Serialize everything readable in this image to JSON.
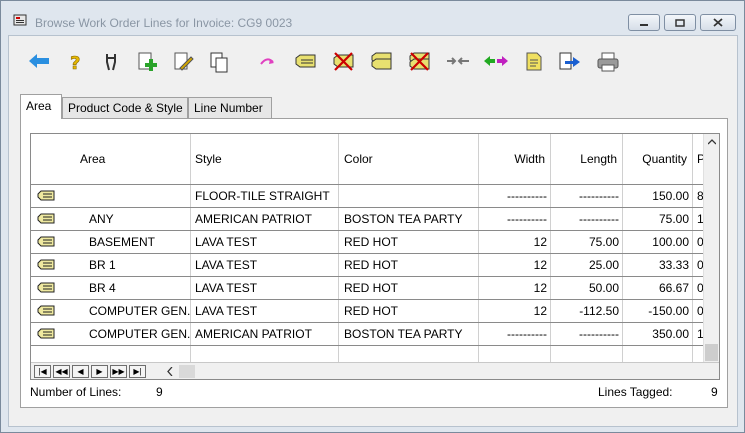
{
  "window": {
    "title": "Browse Work Order Lines for Invoice: CG9 0023"
  },
  "tabs": [
    {
      "label": "Area",
      "active": true
    },
    {
      "label": "Product Code & Style",
      "active": false
    },
    {
      "label": "Line Number",
      "active": false
    }
  ],
  "toolbar": [
    {
      "name": "back-arrow-icon",
      "color": "#2a8fe0"
    },
    {
      "name": "help-icon",
      "color": "#e6b800"
    },
    {
      "name": "tools-icon",
      "color": "#333333"
    },
    {
      "name": "add-line-icon",
      "color": "#2aa32a"
    },
    {
      "name": "edit-line-icon",
      "color": "#d4a800"
    },
    {
      "name": "copy-line-icon",
      "color": "#333333"
    },
    {
      "name": "redo-icon",
      "color": "#e040c0"
    },
    {
      "name": "tag-line-icon",
      "color": "#e8e070"
    },
    {
      "name": "untag-line-icon",
      "color": "#cc0000"
    },
    {
      "name": "tag-all-icon",
      "color": "#e8e070"
    },
    {
      "name": "untag-all-icon",
      "color": "#cc0000"
    },
    {
      "name": "transfer-icon",
      "color": "#777777"
    },
    {
      "name": "swap-icon",
      "color": "#22aa22"
    },
    {
      "name": "note-icon",
      "color": "#f0e060"
    },
    {
      "name": "export-icon",
      "color": "#1a5fd0"
    },
    {
      "name": "print-icon",
      "color": "#555555"
    }
  ],
  "columns": [
    "Area",
    "Style",
    "Color",
    "Width",
    "Length",
    "Quantity",
    "P"
  ],
  "rows": [
    {
      "area": "",
      "style": "FLOOR-TILE STRAIGHT",
      "color": "",
      "width": "----------",
      "length": "----------",
      "quantity": "150.00",
      "p": "8"
    },
    {
      "area": "ANY",
      "style": "AMERICAN PATRIOT",
      "color": "BOSTON TEA PARTY",
      "width": "----------",
      "length": "----------",
      "quantity": "75.00",
      "p": "1"
    },
    {
      "area": "BASEMENT",
      "style": "LAVA TEST",
      "color": "RED HOT",
      "width": "12",
      "length": "75.00",
      "quantity": "100.00",
      "p": "0"
    },
    {
      "area": "BR 1",
      "style": "LAVA TEST",
      "color": "RED HOT",
      "width": "12",
      "length": "25.00",
      "quantity": "33.33",
      "p": "0"
    },
    {
      "area": "BR 4",
      "style": "LAVA TEST",
      "color": "RED HOT",
      "width": "12",
      "length": "50.00",
      "quantity": "66.67",
      "p": "0"
    },
    {
      "area": "COMPUTER GEN.",
      "style": "LAVA TEST",
      "color": "RED HOT",
      "width": "12",
      "length": "-112.50",
      "quantity": "-150.00",
      "p": "0"
    },
    {
      "area": "COMPUTER GEN.",
      "style": "AMERICAN PATRIOT",
      "color": "BOSTON TEA PARTY",
      "width": "----------",
      "length": "----------",
      "quantity": "350.00",
      "p": "1"
    }
  ],
  "nav": [
    "|◀",
    "◀◀",
    "◀",
    "▶",
    "▶▶",
    "▶|"
  ],
  "footer": {
    "lines_label": "Number of Lines:",
    "lines_value": "9",
    "tagged_label": "Lines Tagged:",
    "tagged_value": "9"
  }
}
